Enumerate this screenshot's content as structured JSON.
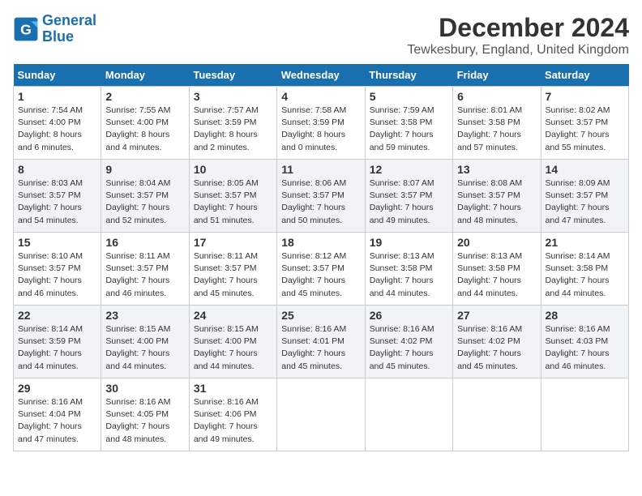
{
  "logo": {
    "line1": "General",
    "line2": "Blue"
  },
  "title": "December 2024",
  "subtitle": "Tewkesbury, England, United Kingdom",
  "headers": [
    "Sunday",
    "Monday",
    "Tuesday",
    "Wednesday",
    "Thursday",
    "Friday",
    "Saturday"
  ],
  "weeks": [
    [
      {
        "day": "1",
        "info": "Sunrise: 7:54 AM\nSunset: 4:00 PM\nDaylight: 8 hours\nand 6 minutes."
      },
      {
        "day": "2",
        "info": "Sunrise: 7:55 AM\nSunset: 4:00 PM\nDaylight: 8 hours\nand 4 minutes."
      },
      {
        "day": "3",
        "info": "Sunrise: 7:57 AM\nSunset: 3:59 PM\nDaylight: 8 hours\nand 2 minutes."
      },
      {
        "day": "4",
        "info": "Sunrise: 7:58 AM\nSunset: 3:59 PM\nDaylight: 8 hours\nand 0 minutes."
      },
      {
        "day": "5",
        "info": "Sunrise: 7:59 AM\nSunset: 3:58 PM\nDaylight: 7 hours\nand 59 minutes."
      },
      {
        "day": "6",
        "info": "Sunrise: 8:01 AM\nSunset: 3:58 PM\nDaylight: 7 hours\nand 57 minutes."
      },
      {
        "day": "7",
        "info": "Sunrise: 8:02 AM\nSunset: 3:57 PM\nDaylight: 7 hours\nand 55 minutes."
      }
    ],
    [
      {
        "day": "8",
        "info": "Sunrise: 8:03 AM\nSunset: 3:57 PM\nDaylight: 7 hours\nand 54 minutes."
      },
      {
        "day": "9",
        "info": "Sunrise: 8:04 AM\nSunset: 3:57 PM\nDaylight: 7 hours\nand 52 minutes."
      },
      {
        "day": "10",
        "info": "Sunrise: 8:05 AM\nSunset: 3:57 PM\nDaylight: 7 hours\nand 51 minutes."
      },
      {
        "day": "11",
        "info": "Sunrise: 8:06 AM\nSunset: 3:57 PM\nDaylight: 7 hours\nand 50 minutes."
      },
      {
        "day": "12",
        "info": "Sunrise: 8:07 AM\nSunset: 3:57 PM\nDaylight: 7 hours\nand 49 minutes."
      },
      {
        "day": "13",
        "info": "Sunrise: 8:08 AM\nSunset: 3:57 PM\nDaylight: 7 hours\nand 48 minutes."
      },
      {
        "day": "14",
        "info": "Sunrise: 8:09 AM\nSunset: 3:57 PM\nDaylight: 7 hours\nand 47 minutes."
      }
    ],
    [
      {
        "day": "15",
        "info": "Sunrise: 8:10 AM\nSunset: 3:57 PM\nDaylight: 7 hours\nand 46 minutes."
      },
      {
        "day": "16",
        "info": "Sunrise: 8:11 AM\nSunset: 3:57 PM\nDaylight: 7 hours\nand 46 minutes."
      },
      {
        "day": "17",
        "info": "Sunrise: 8:11 AM\nSunset: 3:57 PM\nDaylight: 7 hours\nand 45 minutes."
      },
      {
        "day": "18",
        "info": "Sunrise: 8:12 AM\nSunset: 3:57 PM\nDaylight: 7 hours\nand 45 minutes."
      },
      {
        "day": "19",
        "info": "Sunrise: 8:13 AM\nSunset: 3:58 PM\nDaylight: 7 hours\nand 44 minutes."
      },
      {
        "day": "20",
        "info": "Sunrise: 8:13 AM\nSunset: 3:58 PM\nDaylight: 7 hours\nand 44 minutes."
      },
      {
        "day": "21",
        "info": "Sunrise: 8:14 AM\nSunset: 3:58 PM\nDaylight: 7 hours\nand 44 minutes."
      }
    ],
    [
      {
        "day": "22",
        "info": "Sunrise: 8:14 AM\nSunset: 3:59 PM\nDaylight: 7 hours\nand 44 minutes."
      },
      {
        "day": "23",
        "info": "Sunrise: 8:15 AM\nSunset: 4:00 PM\nDaylight: 7 hours\nand 44 minutes."
      },
      {
        "day": "24",
        "info": "Sunrise: 8:15 AM\nSunset: 4:00 PM\nDaylight: 7 hours\nand 44 minutes."
      },
      {
        "day": "25",
        "info": "Sunrise: 8:16 AM\nSunset: 4:01 PM\nDaylight: 7 hours\nand 45 minutes."
      },
      {
        "day": "26",
        "info": "Sunrise: 8:16 AM\nSunset: 4:02 PM\nDaylight: 7 hours\nand 45 minutes."
      },
      {
        "day": "27",
        "info": "Sunrise: 8:16 AM\nSunset: 4:02 PM\nDaylight: 7 hours\nand 45 minutes."
      },
      {
        "day": "28",
        "info": "Sunrise: 8:16 AM\nSunset: 4:03 PM\nDaylight: 7 hours\nand 46 minutes."
      }
    ],
    [
      {
        "day": "29",
        "info": "Sunrise: 8:16 AM\nSunset: 4:04 PM\nDaylight: 7 hours\nand 47 minutes."
      },
      {
        "day": "30",
        "info": "Sunrise: 8:16 AM\nSunset: 4:05 PM\nDaylight: 7 hours\nand 48 minutes."
      },
      {
        "day": "31",
        "info": "Sunrise: 8:16 AM\nSunset: 4:06 PM\nDaylight: 7 hours\nand 49 minutes."
      },
      {
        "day": "",
        "info": ""
      },
      {
        "day": "",
        "info": ""
      },
      {
        "day": "",
        "info": ""
      },
      {
        "day": "",
        "info": ""
      }
    ]
  ]
}
